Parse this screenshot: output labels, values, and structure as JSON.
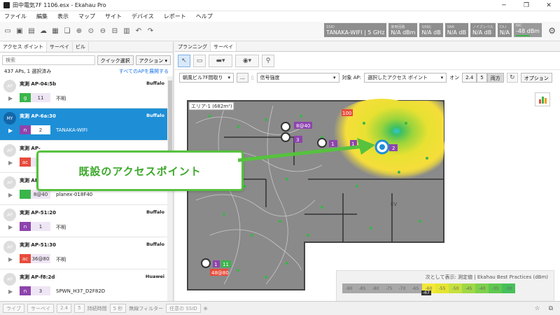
{
  "window": {
    "title": "田中電気7F 1106.esx - Ekahau Pro"
  },
  "menu": [
    "ファイル",
    "編集",
    "表示",
    "マップ",
    "サイト",
    "デバイス",
    "レポート",
    "ヘルプ"
  ],
  "stats": [
    {
      "label": "SSID",
      "value": "TANAKA-WIFI | 5 GHz"
    },
    {
      "label": "使用回路",
      "value": "N/A dBm"
    },
    {
      "label": "S/N比",
      "value": "N/A dB"
    },
    {
      "label": "SNR",
      "value": "N/A dB"
    },
    {
      "label": "ノイズレベル",
      "value": "N/A dB"
    },
    {
      "label": "Ch.l",
      "value": "N/A"
    }
  ],
  "nic": {
    "label": "NIC",
    "value": "-48 dBm"
  },
  "left": {
    "tabs": [
      "アクセス ポイント",
      "サーベイ",
      "ビル"
    ],
    "search_placeholder": "検索",
    "quick_select": "クイック選択",
    "actions": "アクション",
    "count": "437 APs, 1 選択済み",
    "expand_all": "すべてのAPを展開する",
    "aps": [
      {
        "name": "実測 AP-04:5b",
        "vendor": "Buffalo",
        "band": "g",
        "band_color": "#3ab54a",
        "channel": "11",
        "ssid": "不明",
        "avatar": "AP"
      },
      {
        "name": "実測 AP-6a:30",
        "vendor": "Buffalo",
        "band": "n",
        "band_color": "#8e44ad",
        "channel": "2",
        "ssid": "TANAKA-WIFI",
        "avatar": "MY",
        "selected": true
      },
      {
        "name": "実測 AP-",
        "vendor": "",
        "band": "ac",
        "band_color": "#e74c3c",
        "channel": "",
        "ssid": "",
        "avatar": "AP"
      },
      {
        "name": "実測 AP-",
        "vendor": "",
        "band": "",
        "band_color": "#3ab54a",
        "channel": "8@40",
        "ssid": "planex-018F40",
        "avatar": "AP"
      },
      {
        "name": "実測 AP-51:20",
        "vendor": "Buffalo",
        "band": "n",
        "band_color": "#8e44ad",
        "channel": "1",
        "ssid": "不明",
        "avatar": "AP"
      },
      {
        "name": "実測 AP-51:30",
        "vendor": "Buffalo",
        "band": "ac",
        "band_color": "#e74c3c",
        "channel": "36@80",
        "ssid": "不明",
        "avatar": "AP"
      },
      {
        "name": "実測 AP-f8:2d",
        "vendor": "Huawei",
        "band": "n",
        "band_color": "#8e44ad",
        "channel": "3",
        "ssid": "SPWN_H37_D2F82D",
        "avatar": "AP"
      }
    ]
  },
  "right": {
    "tabs": [
      "プランニング",
      "サーベイ"
    ],
    "floor": "朝風ビル7F間取り",
    "more": "...",
    "visualization": "信号強度",
    "target_label": "対象 AP:",
    "target": "選択したアクセス ポイント",
    "on_label": "オン",
    "bands": [
      "2.4",
      "5",
      "両方"
    ],
    "options": "オプション",
    "area_label": "エリア-1 (682m²)",
    "legend_title": "次として表示: 測定値 | Ekahau Best Practices (dBm)",
    "legend_values": [
      "-90",
      "-85",
      "-80",
      "-75",
      "-70",
      "-65",
      "-60",
      "-55",
      "-50",
      "-45",
      "-40",
      "-35",
      "-30"
    ],
    "legend_colors": [
      "#a8a8a8",
      "#a8a8a8",
      "#a8a8a8",
      "#a8a8a8",
      "#a8a8a8",
      "#a8a8a8",
      "#f5e836",
      "#e5e532",
      "#c6e03e",
      "#a0d846",
      "#7ed04c",
      "#5ec850",
      "#46c05a"
    ],
    "legend_marker": "-67",
    "map_labels": [
      "8@40",
      "3",
      "1",
      "100",
      "1",
      "2",
      "1",
      "11",
      "48@80",
      "EV"
    ]
  },
  "callout": {
    "text": "既設のアクセスポイント"
  },
  "status": {
    "live": "ライブ",
    "survey": "サーベイ",
    "b24": "2.4",
    "b5": "5",
    "duration_label": "持続時間",
    "duration": "5 秒",
    "filter_label": "無線フィルター",
    "filter": "任意の SSID"
  }
}
